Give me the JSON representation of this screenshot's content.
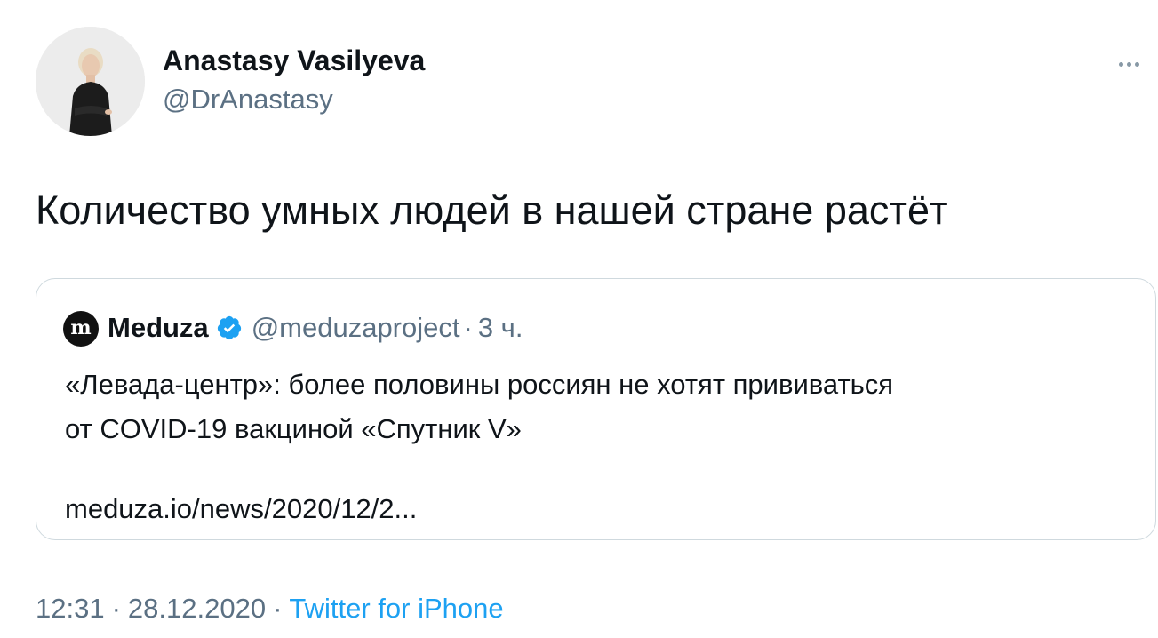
{
  "author": {
    "display_name": "Anastasy Vasilyeva",
    "handle": "@DrAnastasy",
    "avatar_icon": "profile-photo"
  },
  "more_icon": "ellipsis-icon",
  "tweet": {
    "text": "Количество умных людей в нашей стране растёт"
  },
  "quoted_tweet": {
    "avatar_letter": "m",
    "name": "Meduza",
    "verified_icon": "verified-badge-icon",
    "handle": "@meduzaproject",
    "dot": "·",
    "time": "3 ч.",
    "text_line_1": "«Левада-центр»: более половины россиян не хотят прививаться",
    "text_line_2": "от COVID-19 вакциной «Спутник V»",
    "link": "meduza.io/news/2020/12/2..."
  },
  "meta": {
    "time": "12:31",
    "separator": "·",
    "date": "28.12.2020",
    "source": "Twitter for iPhone"
  },
  "colors": {
    "text": "#0f1419",
    "secondary": "#5b7083",
    "link": "#1da1f2",
    "border": "#cfd9de",
    "verified": "#1da1f2"
  }
}
